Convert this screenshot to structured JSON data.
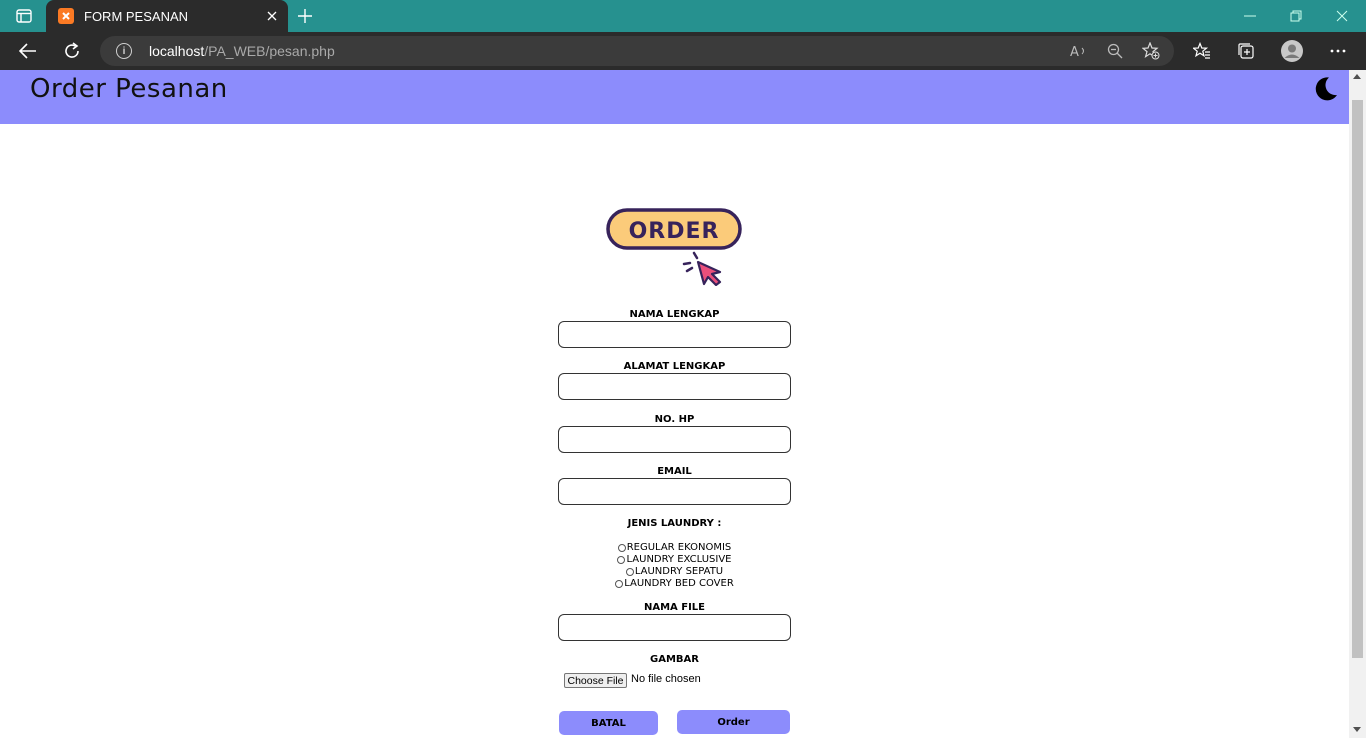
{
  "browser": {
    "tab_title": "FORM PESANAN",
    "url_host": "localhost",
    "url_path": "/PA_WEB/pesan.php"
  },
  "page": {
    "header_title": "Order Pesanan",
    "logo_text": "ORDER",
    "labels": {
      "nama": "NAMA LENGKAP",
      "alamat": "ALAMAT LENGKAP",
      "hp": "NO. HP",
      "email": "EMAIL",
      "jenis": "JENIS LAUNDRY :",
      "nama_file": "NAMA FILE",
      "gambar": "GAMBAR"
    },
    "laundry_options": [
      "REGULAR EKONOMIS",
      "LAUNDRY EXCLUSIVE",
      "LAUNDRY SEPATU",
      "LAUNDRY BED COVER"
    ],
    "file_button": "Choose File",
    "file_status": "No file chosen",
    "cancel_button": "BATAL",
    "order_button": "Order"
  },
  "colors": {
    "tab_bar": "#26918f",
    "header": "#8c8cfc",
    "button": "#8c8cfc"
  }
}
